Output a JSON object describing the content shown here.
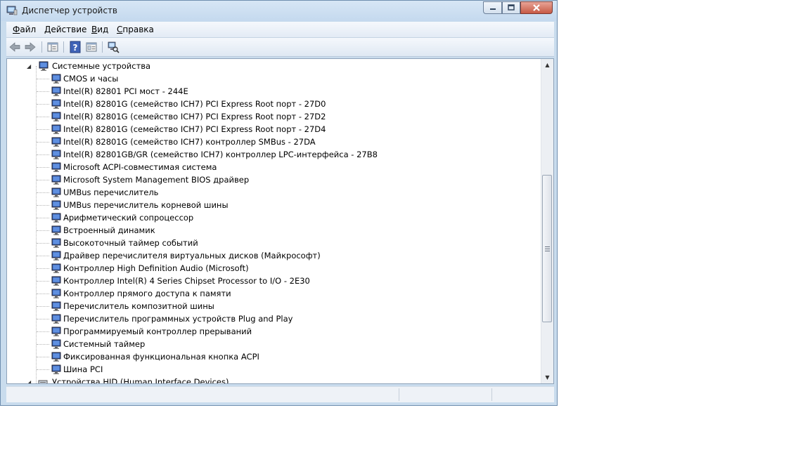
{
  "window": {
    "title": "Диспетчер устройств"
  },
  "menu": [
    {
      "accel": "Ф",
      "rest": "айл"
    },
    {
      "accel": "Д",
      "rest": "ействие"
    },
    {
      "accel": "В",
      "rest": "ид"
    },
    {
      "accel": "С",
      "rest": "правка"
    }
  ],
  "tree": {
    "category": "Системные устройства",
    "devices": [
      "CMOS и часы",
      "Intel(R) 82801 PCI мост - 244E",
      "Intel(R) 82801G (семейство ICH7) PCI Express Root порт - 27D0",
      "Intel(R) 82801G (семейство ICH7) PCI Express Root порт - 27D2",
      "Intel(R) 82801G (семейство ICH7) PCI Express Root порт - 27D4",
      "Intel(R) 82801G (семейство ICH7) контроллер SMBus - 27DA",
      "Intel(R) 82801GB/GR (семейство ICH7) контроллер LPC-интерфейса - 27B8",
      "Microsoft ACPI-совместимая система",
      "Microsoft System Management BIOS драйвер",
      "UMBus перечислитель",
      "UMBus перечислитель корневой шины",
      "Арифметический сопроцессор",
      "Встроенный динамик",
      "Высокоточный таймер событий",
      "Драйвер перечислителя виртуальных дисков (Майкрософт)",
      "Контроллер High Definition Audio (Microsoft)",
      "Контроллер Intel(R) 4 Series Chipset Processor to I/O - 2E30",
      "Контроллер прямого доступа к памяти",
      "Перечислитель композитной шины",
      "Перечислитель программных устройств Plug and Play",
      "Программируемый контроллер прерываний",
      "Системный таймер",
      "Фиксированная функциональная кнопка ACPI",
      "Шина PCI"
    ],
    "next_category": "Устройства HID (Human Interface Devices)"
  },
  "icons": {
    "app": "device-manager-icon",
    "toolbar": [
      "back-arrow-icon",
      "forward-arrow-icon",
      "show-hide-console-tree-icon",
      "help-icon",
      "properties-icon",
      "scan-hardware-icon"
    ],
    "device": "computer-monitor-icon"
  },
  "colors": {
    "titlebar": "#c9dced",
    "close": "#c75a45",
    "tree_bg": "#ffffff"
  }
}
